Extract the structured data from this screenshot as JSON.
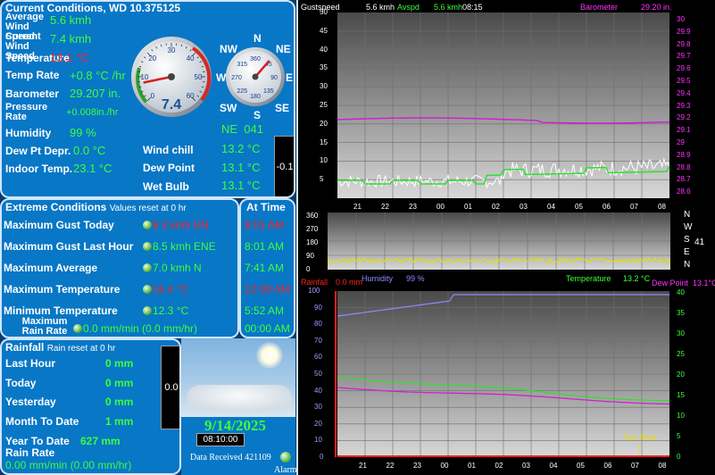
{
  "current": {
    "title": "Current Conditions, WD 10.375125",
    "rows": [
      {
        "label": "Average Wind Speed",
        "value": "5.6 kmh",
        "color": "green"
      },
      {
        "label": "Current Wind Speed",
        "value": "7.4 kmh",
        "color": "green"
      },
      {
        "label": "Temperature",
        "value": "13.1 °C",
        "color": "red"
      },
      {
        "label": "Temp Rate",
        "value": "+0.8 °C /hr",
        "color": "green"
      },
      {
        "label": "Barometer",
        "value": "29.207 in.",
        "color": "green"
      },
      {
        "label": "Pressure Rate",
        "value": "+0.008in./hr",
        "color": "green"
      },
      {
        "label": "Humidity",
        "value": "99 %",
        "color": "green"
      },
      {
        "label": "Dew Pt Depr.",
        "value": "0.0 °C",
        "color": "green"
      },
      {
        "label": "Indoor Temp.",
        "value": "23.1 °C",
        "color": "green"
      }
    ],
    "right_rows": [
      {
        "label": "Wind chill",
        "value": "13.2 °C"
      },
      {
        "label": "Dew Point",
        "value": "13.1 °C"
      },
      {
        "label": "Wet Bulb",
        "value": "13.1 °C"
      }
    ],
    "speed_gauge": {
      "value": 7.4,
      "display": "7.4",
      "max": 60,
      "ticks": [
        "0",
        "10",
        "20",
        "30",
        "40",
        "50",
        "60"
      ]
    },
    "compass": {
      "labels": [
        "N",
        "NE",
        "E",
        "SE",
        "S",
        "SW",
        "W",
        "NW"
      ],
      "ticks": [
        "360",
        "45",
        "90",
        "135",
        "180",
        "225",
        "270",
        "315"
      ],
      "direction": 41,
      "readout": "NE  041"
    },
    "side_box": "-0.1"
  },
  "extreme": {
    "title": "Extreme Conditions",
    "subtitle": "Values reset at 0 hr",
    "time_title": "At Time",
    "rows": [
      {
        "label": "Maximum Gust Today",
        "value": "9.3 kmh EN",
        "color": "red",
        "time": "8:01 AM",
        "time_color": "red"
      },
      {
        "label": "Maximum Gust Last Hour",
        "value": "8.5 kmh ENE",
        "color": "green",
        "time": "8:01 AM",
        "time_color": "green"
      },
      {
        "label": "Maximum Average",
        "value": "7.0 kmh  N",
        "color": "green",
        "time": "7:41 AM",
        "time_color": "green"
      },
      {
        "label": "Maximum Temperature",
        "value": "16.4 °C",
        "color": "red",
        "time": "12:00 AM",
        "time_color": "red"
      },
      {
        "label": "Minimum Temperature",
        "value": "12.3 °C",
        "color": "green",
        "time": "5:52 AM",
        "time_color": "green"
      },
      {
        "label": "Maximum Rain Rate",
        "value": "0.0 mm/min (0.0 mm/hr)",
        "color": "green",
        "time": "00:00 AM",
        "time_color": "green"
      }
    ]
  },
  "rainfall": {
    "title": "Rainfall",
    "subtitle": "Rain reset at 0 hr",
    "rows": [
      {
        "label": "Last Hour",
        "value": "0 mm"
      },
      {
        "label": "Today",
        "value": "0 mm"
      },
      {
        "label": "Yesterday",
        "value": "0 mm"
      },
      {
        "label": "Month To Date",
        "value": "1 mm"
      },
      {
        "label": "Year To Date",
        "value": "627 mm"
      }
    ],
    "rate_label": "Rain Rate",
    "rate_value": "0.00 mm/min (0.00 mm/hr)",
    "box": "0.0"
  },
  "weather": {
    "date": "9/14/2025",
    "time": "08:10:00",
    "data_received": "Data Received 421109",
    "alarm": "Alarm"
  },
  "graphs": {
    "wind": {
      "gust_label": "Gustspeed",
      "gust_value": "5.6 kmh",
      "avg_label": "Avspd",
      "avg_value": "5.6 kmh",
      "time": "08:15",
      "baro_label": "Barometer",
      "baro_value": "29.20 in.",
      "left_ticks": [
        "50",
        "45",
        "40",
        "35",
        "30",
        "25",
        "20",
        "15",
        "10",
        "5"
      ],
      "right_ticks": [
        "30",
        "29.9",
        "29.8",
        "29.7",
        "29.6",
        "29.5",
        "29.4",
        "29.3",
        "29.2",
        "29.1",
        "29",
        "28.9",
        "28.8",
        "28.7",
        "28.6"
      ]
    },
    "x_labels": [
      "21",
      "22",
      "23",
      "00",
      "01",
      "02",
      "03",
      "04",
      "05",
      "06",
      "07",
      "08"
    ],
    "direction": {
      "ticks": [
        "360",
        "270",
        "180",
        "90",
        "0"
      ],
      "compass": [
        "N",
        "W",
        "S",
        "E",
        "N"
      ],
      "value": "41"
    },
    "temp": {
      "rain_label": "Rainfall",
      "rain_value": "0.0 mm",
      "hum_label": "Humidity",
      "hum_value": "99 %",
      "temp_label": "Temperature",
      "temp_value": "13.2 °C",
      "dew_label": "Dew Point",
      "dew_value": "13.1°C",
      "left_ticks": [
        "100",
        "90",
        "80",
        "70",
        "60",
        "50",
        "40",
        "30",
        "20",
        "10",
        "0"
      ],
      "right_ticks": [
        "40",
        "35",
        "30",
        "25",
        "20",
        "15",
        "10",
        "5",
        "0"
      ],
      "sunrise": "Sun Rise"
    }
  }
}
